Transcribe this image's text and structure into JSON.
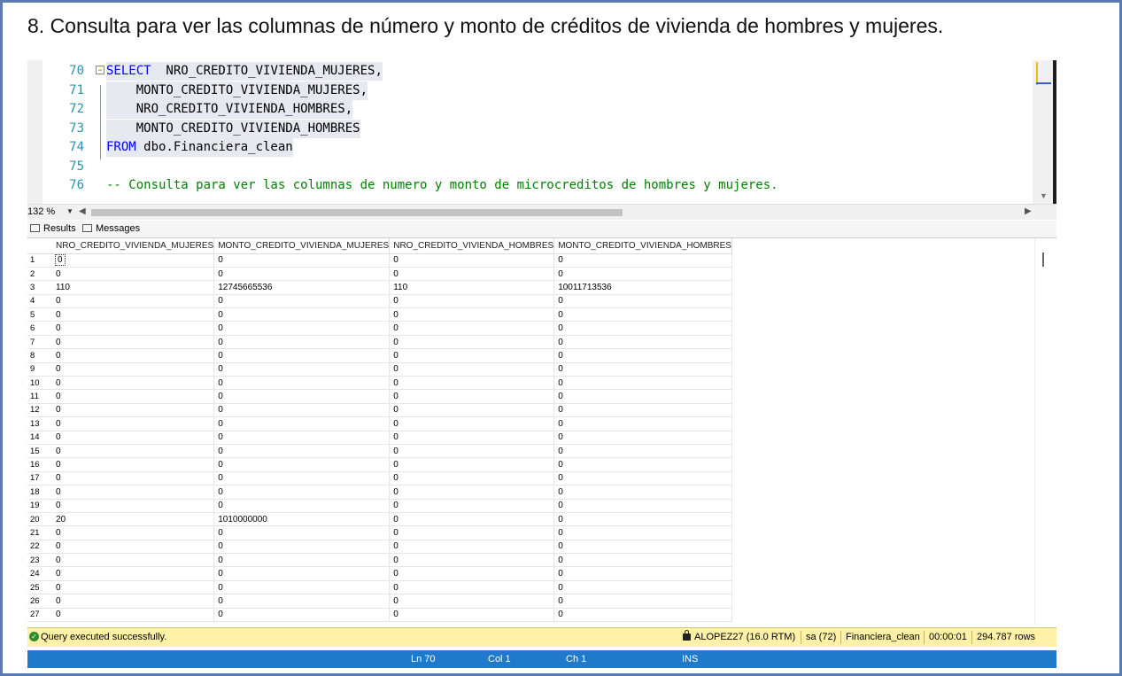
{
  "heading": "8. Consulta para ver las columnas de número y monto de créditos de vivienda de hombres y mujeres.",
  "editor": {
    "lines": [
      {
        "num": "70",
        "kw": "SELECT",
        "text": "  NRO_CREDITO_VIVIENDA_MUJERES,"
      },
      {
        "num": "71",
        "kw": "",
        "text": "    MONTO_CREDITO_VIVIENDA_MUJERES,"
      },
      {
        "num": "72",
        "kw": "",
        "text": "    NRO_CREDITO_VIVIENDA_HOMBRES,"
      },
      {
        "num": "73",
        "kw": "",
        "text": "    MONTO_CREDITO_VIVIENDA_HOMBRES"
      },
      {
        "num": "74",
        "kw": "FROM",
        "text": " dbo.Financiera_clean"
      },
      {
        "num": "75",
        "kw": "",
        "text": ""
      },
      {
        "num": "76",
        "kw": "",
        "text": "-- Consulta para ver las columnas de numero y monto de microcreditos de hombres y mujeres."
      }
    ],
    "zoom": "132 %"
  },
  "tabs": {
    "results": "Results",
    "messages": "Messages"
  },
  "grid": {
    "columns": [
      "NRO_CREDITO_VIVIENDA_MUJERES",
      "MONTO_CREDITO_VIVIENDA_MUJERES",
      "NRO_CREDITO_VIVIENDA_HOMBRES",
      "MONTO_CREDITO_VIVIENDA_HOMBRES"
    ],
    "rows": [
      [
        "1",
        "0",
        "0",
        "0",
        "0"
      ],
      [
        "2",
        "0",
        "0",
        "0",
        "0"
      ],
      [
        "3",
        "110",
        "12745665536",
        "110",
        "10011713536"
      ],
      [
        "4",
        "0",
        "0",
        "0",
        "0"
      ],
      [
        "5",
        "0",
        "0",
        "0",
        "0"
      ],
      [
        "6",
        "0",
        "0",
        "0",
        "0"
      ],
      [
        "7",
        "0",
        "0",
        "0",
        "0"
      ],
      [
        "8",
        "0",
        "0",
        "0",
        "0"
      ],
      [
        "9",
        "0",
        "0",
        "0",
        "0"
      ],
      [
        "10",
        "0",
        "0",
        "0",
        "0"
      ],
      [
        "11",
        "0",
        "0",
        "0",
        "0"
      ],
      [
        "12",
        "0",
        "0",
        "0",
        "0"
      ],
      [
        "13",
        "0",
        "0",
        "0",
        "0"
      ],
      [
        "14",
        "0",
        "0",
        "0",
        "0"
      ],
      [
        "15",
        "0",
        "0",
        "0",
        "0"
      ],
      [
        "16",
        "0",
        "0",
        "0",
        "0"
      ],
      [
        "17",
        "0",
        "0",
        "0",
        "0"
      ],
      [
        "18",
        "0",
        "0",
        "0",
        "0"
      ],
      [
        "19",
        "0",
        "0",
        "0",
        "0"
      ],
      [
        "20",
        "20",
        "1010000000",
        "0",
        "0"
      ],
      [
        "21",
        "0",
        "0",
        "0",
        "0"
      ],
      [
        "22",
        "0",
        "0",
        "0",
        "0"
      ],
      [
        "23",
        "0",
        "0",
        "0",
        "0"
      ],
      [
        "24",
        "0",
        "0",
        "0",
        "0"
      ],
      [
        "25",
        "0",
        "0",
        "0",
        "0"
      ],
      [
        "26",
        "0",
        "0",
        "0",
        "0"
      ],
      [
        "27",
        "0",
        "0",
        "0",
        "0"
      ]
    ]
  },
  "status": {
    "message": "Query executed successfully.",
    "server": "ALOPEZ27 (16.0 RTM)",
    "user": "sa (72)",
    "database": "Financiera_clean",
    "elapsed": "00:00:01",
    "rows": "294.787 rows"
  },
  "bottombar": {
    "ln": "Ln 70",
    "col": "Col 1",
    "ch": "Ch 1",
    "mode": "INS"
  },
  "colors": {
    "keyword": "#0000ff",
    "comment": "#008000",
    "line_number": "#2b91af",
    "status_bg": "#fff1a8",
    "bottombar_bg": "#1f7acc"
  }
}
